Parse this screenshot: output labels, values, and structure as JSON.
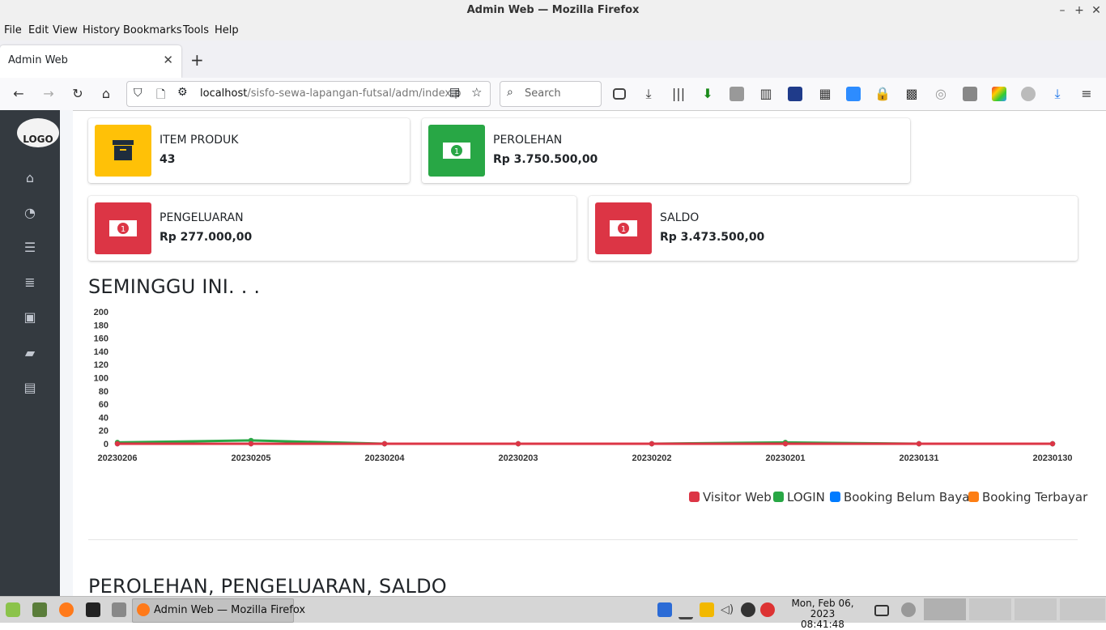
{
  "window": {
    "title": "Admin Web — Mozilla Firefox"
  },
  "menu": [
    "File",
    "Edit",
    "View",
    "History",
    "Bookmarks",
    "Tools",
    "Help"
  ],
  "tab": {
    "label": "Admin Web"
  },
  "address": {
    "host": "localhost",
    "path": "/sisfo-sewa-lapangan-futsal/adm/index.p"
  },
  "search": {
    "placeholder": "Search"
  },
  "sidebar": {
    "logo": "LOGO",
    "icons": [
      "home-icon",
      "dashboard-icon",
      "list-icon",
      "database-icon",
      "money-icon",
      "book-icon",
      "archive-icon"
    ]
  },
  "boxes": {
    "item_produk": {
      "label": "ITEM PRODUK",
      "value": "43",
      "color": "#ffc107",
      "icon": "archive-icon"
    },
    "perolehan": {
      "label": "PEROLEHAN",
      "value": "Rp 3.750.500,00",
      "color": "#28a745",
      "icon": "money-icon"
    },
    "pengeluaran": {
      "label": "PENGELUARAN",
      "value": "Rp 277.000,00",
      "color": "#dc3545",
      "icon": "money-icon"
    },
    "saldo": {
      "label": "SALDO",
      "value": "Rp 3.473.500,00",
      "color": "#dc3545",
      "icon": "money-icon"
    }
  },
  "sections": {
    "weekly_title": "SEMINGGU INI. . .",
    "summary_title": "PEROLEHAN, PENGELUARAN, SALDO"
  },
  "chart_data": {
    "type": "line",
    "categories": [
      "20230206",
      "20230205",
      "20230204",
      "20230203",
      "20230202",
      "20230201",
      "20230131",
      "20230130"
    ],
    "yticks": [
      0,
      20,
      40,
      60,
      80,
      100,
      120,
      140,
      160,
      180,
      200
    ],
    "ylim": [
      0,
      200
    ],
    "legend_position": "bottom-right",
    "series": [
      {
        "name": "Visitor Web",
        "color": "#dc3545",
        "values": [
          0,
          0,
          0,
          0,
          0,
          0,
          0,
          0
        ]
      },
      {
        "name": "LOGIN",
        "color": "#28a745",
        "values": [
          2,
          5,
          0,
          0,
          0,
          2,
          0,
          0
        ]
      },
      {
        "name": "Booking Belum Bayar",
        "color": "#007bff",
        "values": [
          0,
          0,
          0,
          0,
          0,
          0,
          0,
          0
        ]
      },
      {
        "name": "Booking Terbayar",
        "color": "#fd7e14",
        "values": [
          0,
          0,
          0,
          0,
          0,
          0,
          0,
          0
        ]
      }
    ]
  },
  "taskbar": {
    "window_label": "Admin Web — Mozilla Firefox",
    "date": "Mon, Feb 06, 2023",
    "time": "08:41:48"
  }
}
